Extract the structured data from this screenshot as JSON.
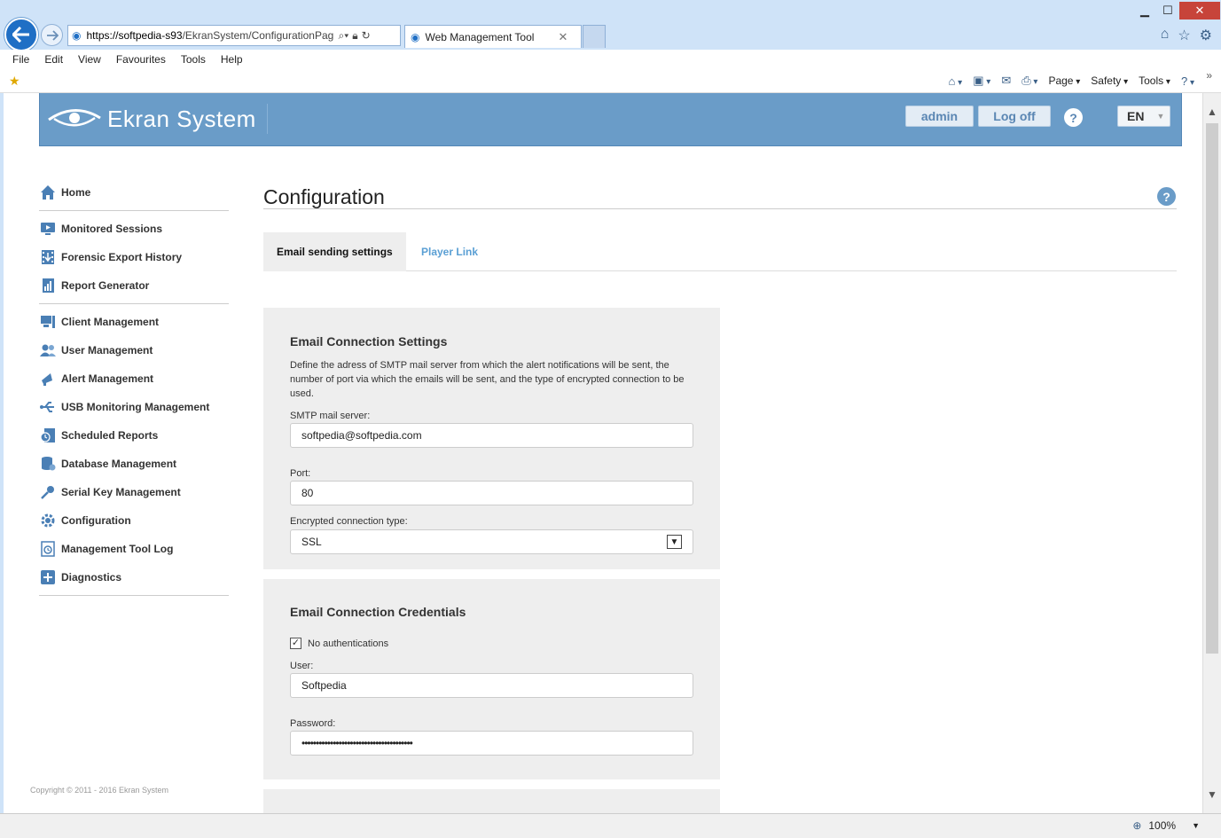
{
  "browser": {
    "url_host": "https://softpedia-s93",
    "url_path": "/EkranSystem/ConfigurationPag",
    "tab_title": "Web Management Tool",
    "menu": [
      "File",
      "Edit",
      "View",
      "Favourites",
      "Tools",
      "Help"
    ],
    "cmd": {
      "page": "Page",
      "safety": "Safety",
      "tools": "Tools"
    },
    "zoom": "100%"
  },
  "header": {
    "brand": "Ekran System",
    "user_label": "admin",
    "logoff_label": "Log off",
    "help_label": "?",
    "lang": "EN"
  },
  "sidebar": {
    "items": [
      {
        "label": "Home",
        "icon": "home-icon"
      },
      {
        "label": "Monitored Sessions",
        "icon": "monitor-play-icon"
      },
      {
        "label": "Forensic Export History",
        "icon": "film-export-icon"
      },
      {
        "label": "Report Generator",
        "icon": "report-icon"
      },
      {
        "label": "Client Management",
        "icon": "computer-icon"
      },
      {
        "label": "User Management",
        "icon": "users-icon"
      },
      {
        "label": "Alert Management",
        "icon": "megaphone-icon"
      },
      {
        "label": "USB Monitoring Management",
        "icon": "usb-icon"
      },
      {
        "label": "Scheduled Reports",
        "icon": "clock-report-icon"
      },
      {
        "label": "Database Management",
        "icon": "database-icon"
      },
      {
        "label": "Serial Key Management",
        "icon": "key-icon"
      },
      {
        "label": "Configuration",
        "icon": "gear-icon"
      },
      {
        "label": "Management Tool Log",
        "icon": "log-icon"
      },
      {
        "label": "Diagnostics",
        "icon": "diagnostics-icon"
      }
    ],
    "copyright": "Copyright © 2011 - 2016 Ekran System"
  },
  "main": {
    "title": "Configuration",
    "tabs": [
      {
        "label": "Email sending settings"
      },
      {
        "label": "Player Link"
      }
    ],
    "connection": {
      "heading": "Email Connection Settings",
      "description": "Define the adress of SMTP mail server from which the alert notifications will be sent, the number of port via which the emails will be sent, and the type of encrypted connection to be used.",
      "smtp_label": "SMTP mail server:",
      "smtp_value": "softpedia@softpedia.com",
      "port_label": "Port:",
      "port_value": "80",
      "enc_label": "Encrypted connection type:",
      "enc_value": "SSL"
    },
    "credentials": {
      "heading": "Email Connection Credentials",
      "no_auth_label": "No authentications",
      "no_auth_checked": true,
      "user_label": "User:",
      "user_value": "Softpedia",
      "password_label": "Password:",
      "password_value": "•••••••••••••••••••••••••••••••••••••••"
    }
  }
}
